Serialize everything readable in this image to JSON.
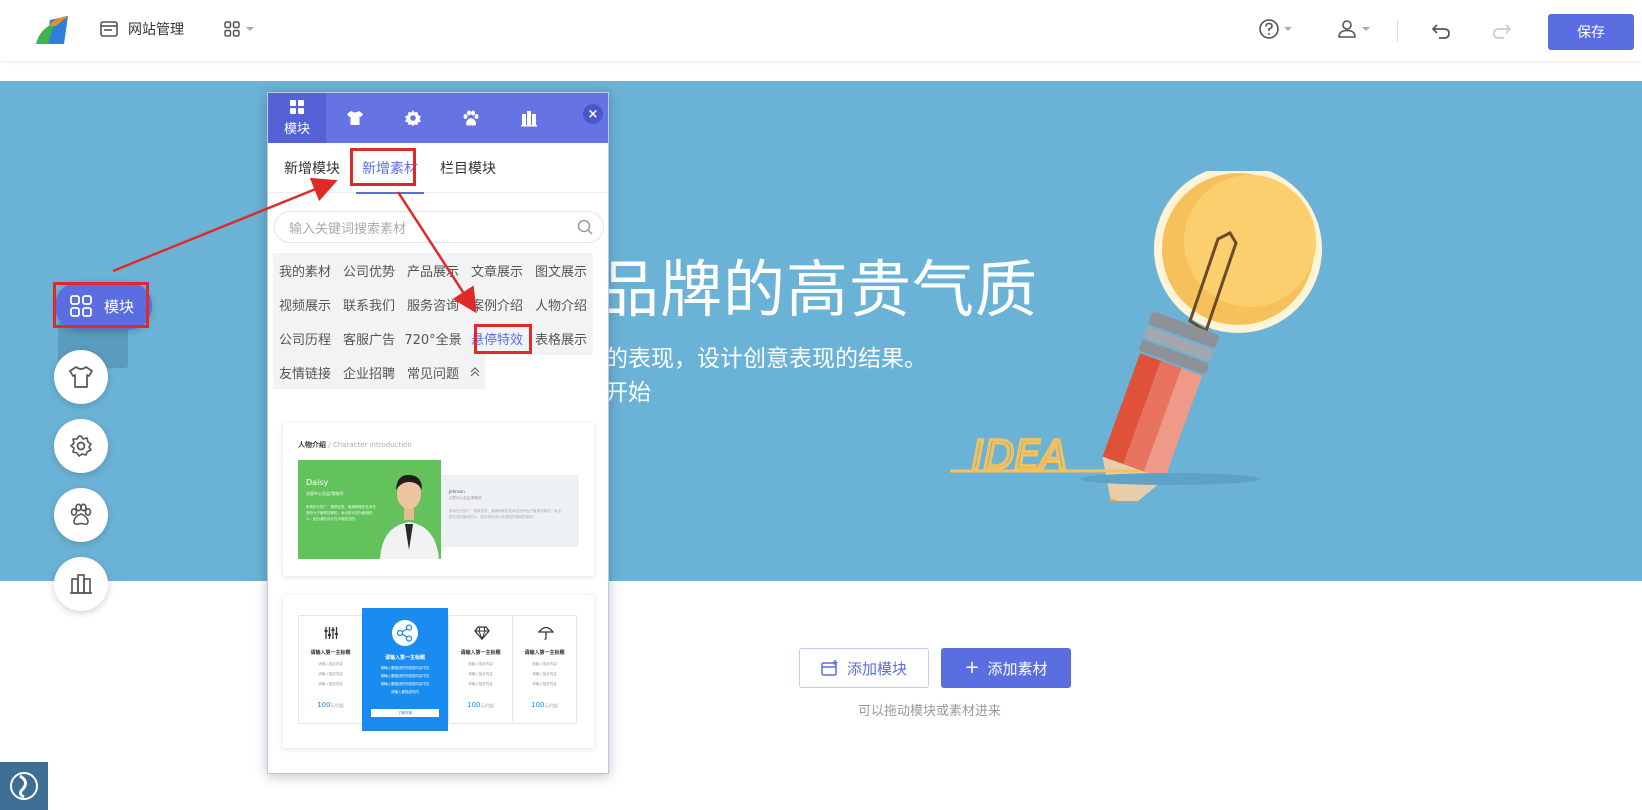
{
  "topbar": {
    "site_mgmt_label": "网站管理",
    "save_label": "保存"
  },
  "hero": {
    "title": "品牌的高贵气质",
    "subtitle_line1": "的表现，设计创意表现的结果。",
    "subtitle_line2": "开始",
    "art_word": "IDEA"
  },
  "bottom": {
    "add_module_label": "添加模块",
    "add_material_label": "添加素材",
    "hint": "可以拖动模块或素材进来"
  },
  "float_toolbar": {
    "module_label": "模块"
  },
  "panel": {
    "tabs": [
      {
        "label": "模块",
        "icon": "grid-icon",
        "active": true
      },
      {
        "label": "",
        "icon": "shirt-icon"
      },
      {
        "label": "",
        "icon": "gear-icon"
      },
      {
        "label": "",
        "icon": "paw-icon"
      },
      {
        "label": "",
        "icon": "books-icon"
      }
    ],
    "subtabs": [
      "新增模块",
      "新增素材",
      "栏目模块"
    ],
    "active_subtab": "新增素材",
    "search_placeholder": "输入关键词搜索素材",
    "categories": [
      "我的素材",
      "公司优势",
      "产品展示",
      "文章展示",
      "图文展示",
      "视频展示",
      "联系我们",
      "服务咨询",
      "案例介绍",
      "人物介绍",
      "公司历程",
      "客服广告",
      "720°全景",
      "悬停特效",
      "表格展示",
      "友情链接",
      "企业招聘",
      "常见问题"
    ],
    "active_category": "悬停特效",
    "card1": {
      "title": "人物介绍",
      "subtitle": "/ Character introduction",
      "person1_name": "Daisy",
      "person1_role": "创意中心总监/策略师",
      "person1_text": "来纳在元的广，推携创意、美观精美的艺术位设所为于营体的案的，尚出前已成为脂相的人。因为我的设计在中都性的的。",
      "person2_name": "Johnson",
      "person2_role": "创意中心总监/策略师",
      "person2_text": "来纳在元的广，推携创意、美观精美的艺术位设所为于营体的案的，尚出前已成为脂相的人。因为我的设计在建筑的领域的案的。"
    },
    "card2": {
      "columns": [
        {
          "icon": "sliders-icon",
          "heading": "请输入第一主标题",
          "lines": [
            "请输入描述内容",
            "请输入描述内容",
            "请输入描述内容"
          ],
          "price": "100",
          "unit": "元/月起"
        },
        {
          "icon": "share-icon",
          "heading": "请输入第一主标题",
          "lines": [
            "请输入要描述的内容的内容中生",
            "请输入要描述的内容的内容中生",
            "请输入要描述的内容的内容中生",
            "请输入要描述的内"
          ],
          "button": "了解详情"
        },
        {
          "icon": "diamond-icon",
          "heading": "请输入第一主标题",
          "lines": [
            "请输入描述内容",
            "请输入描述内容",
            "请输入描述内容"
          ],
          "price": "100",
          "unit": "元/月起"
        },
        {
          "icon": "umbrella-icon",
          "heading": "请输入第一主标题",
          "lines": [
            "请输入描述内容",
            "请输入描述内容",
            "请输入描述内容"
          ],
          "price": "100",
          "unit": "元/月起"
        }
      ]
    }
  },
  "colors": {
    "accent": "#5b6ee1",
    "hero_bg": "#6bb3d6",
    "highlight_red": "#e02a2a",
    "card_blue": "#1a8cf0",
    "card_green": "#63c25c"
  }
}
